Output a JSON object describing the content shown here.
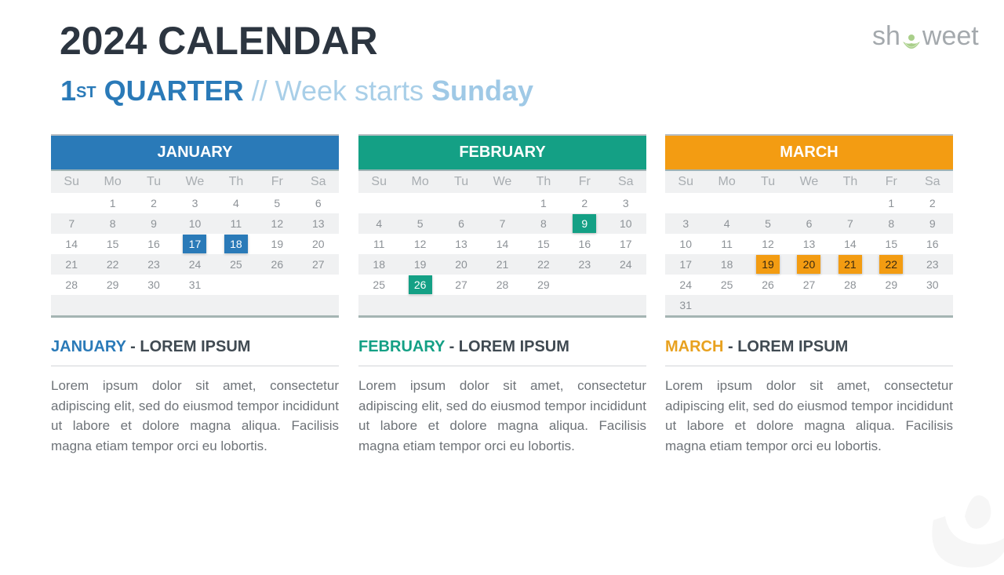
{
  "header": {
    "title": "2024 CALENDAR",
    "quarter_num": "1",
    "quarter_sup": "ST",
    "quarter_word": "QUARTER",
    "separator": "// Week starts ",
    "week_start": "Sunday"
  },
  "logo": {
    "text_left": "sh",
    "text_right": "weet",
    "icon": "leaf-heart-icon"
  },
  "weekdays": [
    "Su",
    "Mo",
    "Tu",
    "We",
    "Th",
    "Fr",
    "Sa"
  ],
  "colors": {
    "january": "#2a7ab8",
    "february": "#14a085",
    "march": "#f39c12"
  },
  "months": [
    {
      "name": "JANUARY",
      "color": "#2a7ab8",
      "weeks": [
        [
          "",
          "1",
          "2",
          "3",
          "4",
          "5",
          "6"
        ],
        [
          "7",
          "8",
          "9",
          "10",
          "11",
          "12",
          "13"
        ],
        [
          "14",
          "15",
          "16",
          "17",
          "18",
          "19",
          "20"
        ],
        [
          "21",
          "22",
          "23",
          "24",
          "25",
          "26",
          "27"
        ],
        [
          "28",
          "29",
          "30",
          "31",
          "",
          "",
          ""
        ],
        [
          "",
          "",
          "",
          "",
          "",
          "",
          ""
        ]
      ],
      "highlighted": [
        "17",
        "18"
      ],
      "desc_title": "JANUARY",
      "desc_suffix": " - LOREM IPSUM",
      "desc_text": "Lorem ipsum dolor sit amet, consectetur adipiscing elit, sed do eiusmod tempor incididunt ut labore et dolore magna aliqua. Facilisis magna etiam tempor orci eu lobortis."
    },
    {
      "name": "FEBRUARY",
      "color": "#14a085",
      "weeks": [
        [
          "",
          "",
          "",
          "",
          "1",
          "2",
          "3"
        ],
        [
          "4",
          "5",
          "6",
          "7",
          "8",
          "9",
          "10"
        ],
        [
          "11",
          "12",
          "13",
          "14",
          "15",
          "16",
          "17"
        ],
        [
          "18",
          "19",
          "20",
          "21",
          "22",
          "23",
          "24"
        ],
        [
          "25",
          "26",
          "27",
          "28",
          "29",
          "",
          ""
        ],
        [
          "",
          "",
          "",
          "",
          "",
          "",
          ""
        ]
      ],
      "highlighted": [
        "9",
        "26"
      ],
      "desc_title": "FEBRUARY",
      "desc_suffix": " - LOREM IPSUM",
      "desc_text": "Lorem ipsum dolor sit amet, consectetur adipiscing elit, sed do eiusmod tempor incididunt ut labore et dolore magna aliqua. Facilisis magna etiam tempor orci eu lobortis."
    },
    {
      "name": "MARCH",
      "color": "#f39c12",
      "weeks": [
        [
          "",
          "",
          "",
          "",
          "",
          "1",
          "2"
        ],
        [
          "3",
          "4",
          "5",
          "6",
          "7",
          "8",
          "9"
        ],
        [
          "10",
          "11",
          "12",
          "13",
          "14",
          "15",
          "16"
        ],
        [
          "17",
          "18",
          "19",
          "20",
          "21",
          "22",
          "23"
        ],
        [
          "24",
          "25",
          "26",
          "27",
          "28",
          "29",
          "30"
        ],
        [
          "31",
          "",
          "",
          "",
          "",
          "",
          ""
        ]
      ],
      "highlighted": [
        "19",
        "20",
        "21",
        "22"
      ],
      "desc_title": "MARCH",
      "desc_suffix": " - LOREM IPSUM",
      "desc_text": "Lorem ipsum dolor sit amet, consectetur adipiscing elit, sed do eiusmod tempor incididunt ut labore et dolore magna aliqua. Facilisis magna etiam tempor orci eu lobortis."
    }
  ]
}
